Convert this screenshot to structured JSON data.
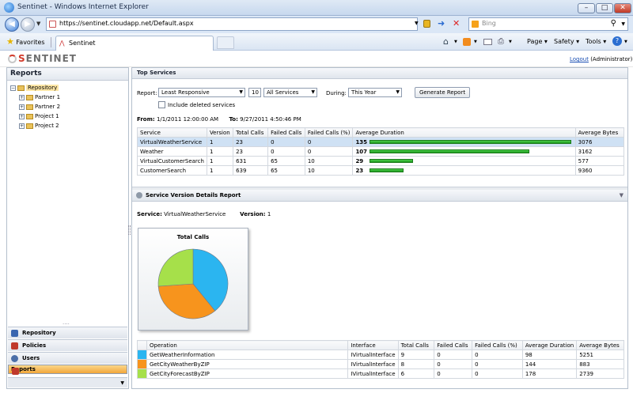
{
  "browser": {
    "title": "Sentinet - Windows Internet Explorer",
    "url": "https://sentinet.cloudapp.net/Default.aspx",
    "search_placeholder": "Bing",
    "favorites_label": "Favorites",
    "tab_label": "Sentinet",
    "cmd_page": "Page",
    "cmd_safety": "Safety",
    "cmd_tools": "Tools"
  },
  "app": {
    "logo_prefix": "S",
    "logo_text": "ENTINET",
    "logout_label": "Logout",
    "user": "(Administrator)"
  },
  "left": {
    "title": "Reports",
    "tree": [
      {
        "label": "Repository"
      },
      {
        "label": "Partner 1"
      },
      {
        "label": "Partner 2"
      },
      {
        "label": "Project 1"
      },
      {
        "label": "Project 2"
      }
    ],
    "nav": [
      {
        "label": "Repository",
        "color": "#3a66b0"
      },
      {
        "label": "Policies",
        "color": "#c0392b"
      },
      {
        "label": "Users",
        "color": "#4b6fa8"
      },
      {
        "label": "Reports",
        "color": "#c0392b"
      }
    ]
  },
  "top_services": {
    "title": "Top Services",
    "report_label": "Report:",
    "report_value": "Least Responsive",
    "count_value": "10",
    "scope_value": "All Services",
    "during_label": "During:",
    "during_value": "This Year",
    "generate_label": "Generate Report",
    "include_deleted_label": "Include deleted services",
    "from_label": "From:",
    "from_value": "1/1/2011 12:00:00 AM",
    "to_label": "To:",
    "to_value": "9/27/2011 4:50:46 PM",
    "columns": [
      "Service",
      "Version",
      "Total Calls",
      "Failed Calls",
      "Failed Calls (%)",
      "Average Duration",
      "Average Bytes"
    ],
    "max_duration": 135,
    "rows": [
      {
        "service": "VirtualWeatherService",
        "version": "1",
        "total": "23",
        "failed": "0",
        "failed_pct": "0",
        "duration": 135,
        "bytes": "3076",
        "selected": true
      },
      {
        "service": "Weather",
        "version": "1",
        "total": "23",
        "failed": "0",
        "failed_pct": "0",
        "duration": 107,
        "bytes": "3162",
        "selected": false
      },
      {
        "service": "VirtualCustomerSearch",
        "version": "1",
        "total": "631",
        "failed": "65",
        "failed_pct": "10",
        "duration": 29,
        "bytes": "577",
        "selected": false
      },
      {
        "service": "CustomerSearch",
        "version": "1",
        "total": "639",
        "failed": "65",
        "failed_pct": "10",
        "duration": 23,
        "bytes": "9360",
        "selected": false
      }
    ]
  },
  "details": {
    "title": "Service Version Details Report",
    "service_label": "Service:",
    "service_value": "VirtualWeatherService",
    "version_label": "Version:",
    "version_value": "1",
    "columns": [
      "Operation",
      "Interface",
      "Total Calls",
      "Failed Calls",
      "Failed Calls (%)",
      "Average Duration",
      "Average Bytes"
    ],
    "rows": [
      {
        "color": "#2bb5f0",
        "operation": "GetWeatherInformation",
        "interface": "IVirtualInterface",
        "total": "9",
        "failed": "0",
        "failed_pct": "0",
        "duration": "98",
        "bytes": "5251"
      },
      {
        "color": "#f7941d",
        "operation": "GetCityWeatherByZIP",
        "interface": "IVirtualInterface",
        "total": "8",
        "failed": "0",
        "failed_pct": "0",
        "duration": "144",
        "bytes": "883"
      },
      {
        "color": "#a6e04a",
        "operation": "GetCityForecastByZIP",
        "interface": "IVirtualInterface",
        "total": "6",
        "failed": "0",
        "failed_pct": "0",
        "duration": "178",
        "bytes": "2739"
      }
    ]
  },
  "chart_data": {
    "type": "pie",
    "title": "Total Calls",
    "categories": [
      "GetWeatherInformation",
      "GetCityWeatherByZIP",
      "GetCityForecastByZIP"
    ],
    "values": [
      9,
      8,
      6
    ],
    "colors": [
      "#2bb5f0",
      "#f7941d",
      "#a6e04a"
    ]
  }
}
